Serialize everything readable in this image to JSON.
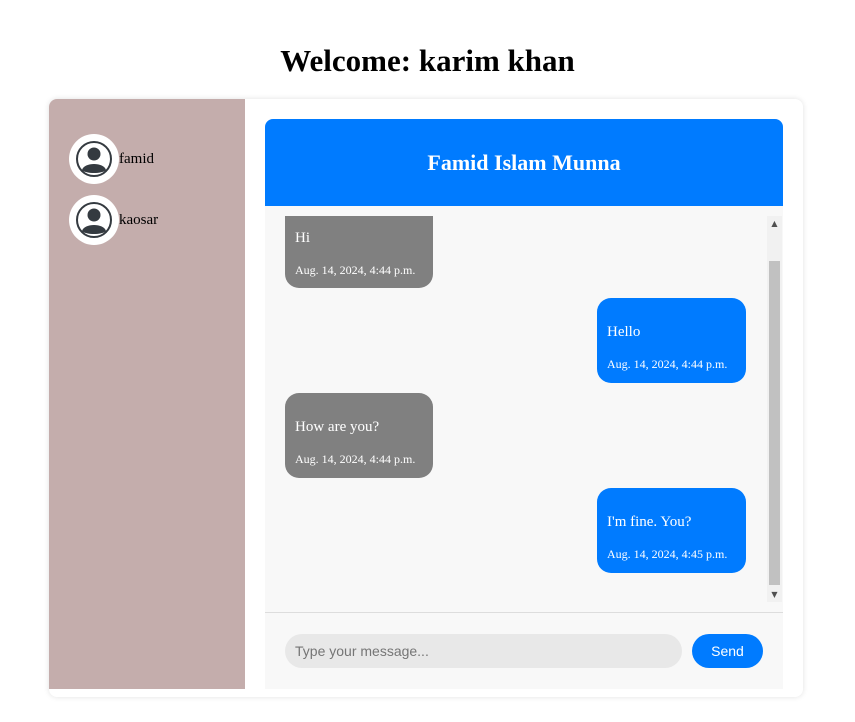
{
  "page": {
    "title": "Welcome: karim khan"
  },
  "sidebar": {
    "contacts": [
      {
        "name": "famid",
        "icon": "user-avatar-icon"
      },
      {
        "name": "kaosar",
        "icon": "user-avatar-icon"
      }
    ],
    "background": "#c4adac"
  },
  "chat": {
    "header": "Famid Islam Munna",
    "accent": "#007bff",
    "messages": [
      {
        "direction": "received",
        "text": "Hi",
        "time": "Aug. 14, 2024, 4:44 p.m."
      },
      {
        "direction": "sent",
        "text": "Hello",
        "time": "Aug. 14, 2024, 4:44 p.m."
      },
      {
        "direction": "received",
        "text": "How are you?",
        "time": "Aug. 14, 2024, 4:44 p.m."
      },
      {
        "direction": "sent",
        "text": "I'm fine. You?",
        "time": "Aug. 14, 2024, 4:45 p.m."
      }
    ],
    "input": {
      "placeholder": "Type your message...",
      "value": ""
    },
    "send_label": "Send"
  }
}
